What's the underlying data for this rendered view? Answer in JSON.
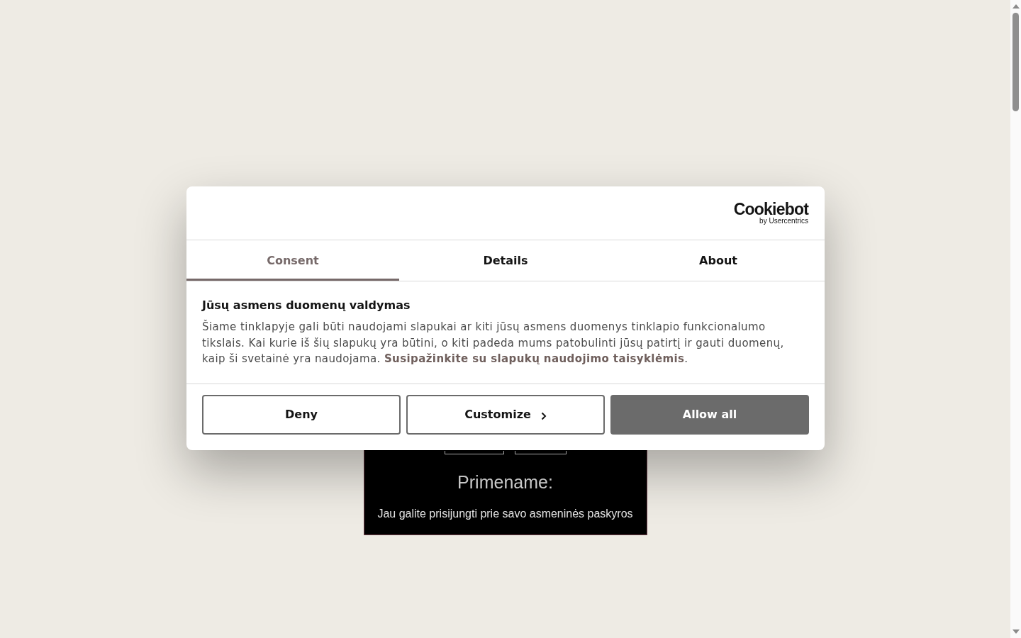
{
  "page": {
    "heading": "Primename:",
    "text": "Jau galite prisijungti prie savo asmeninės paskyros"
  },
  "dialog": {
    "logo": {
      "name": "Cookiebot",
      "tagline": "by Usercentrics"
    },
    "tabs": [
      {
        "label": "Consent",
        "selected": true
      },
      {
        "label": "Details",
        "selected": false
      },
      {
        "label": "About",
        "selected": false
      }
    ],
    "title": "Jūsų asmens duomenų valdymas",
    "text": [
      {
        "kind": "text",
        "text": "Šiame tinklapyje gali būti naudojami slapukai ar kiti jūsų asmens duomenys tinklapio funkcionalumo tikslais. Kai kurie iš šių slapukų yra būtini, o kiti padeda mums patobulinti jūsų patirtį ir gauti duomenų, kaip ši svetainė yra naudojama. "
      },
      {
        "kind": "link",
        "text": "Susipažinkite su slapukų naudojimo taisyklėmis"
      },
      {
        "kind": "text",
        "text": "."
      }
    ],
    "buttons": [
      {
        "label": "Deny",
        "kind": "outline"
      },
      {
        "label": "Customize",
        "kind": "outline-next"
      },
      {
        "label": "Allow all",
        "kind": "filled"
      }
    ]
  }
}
